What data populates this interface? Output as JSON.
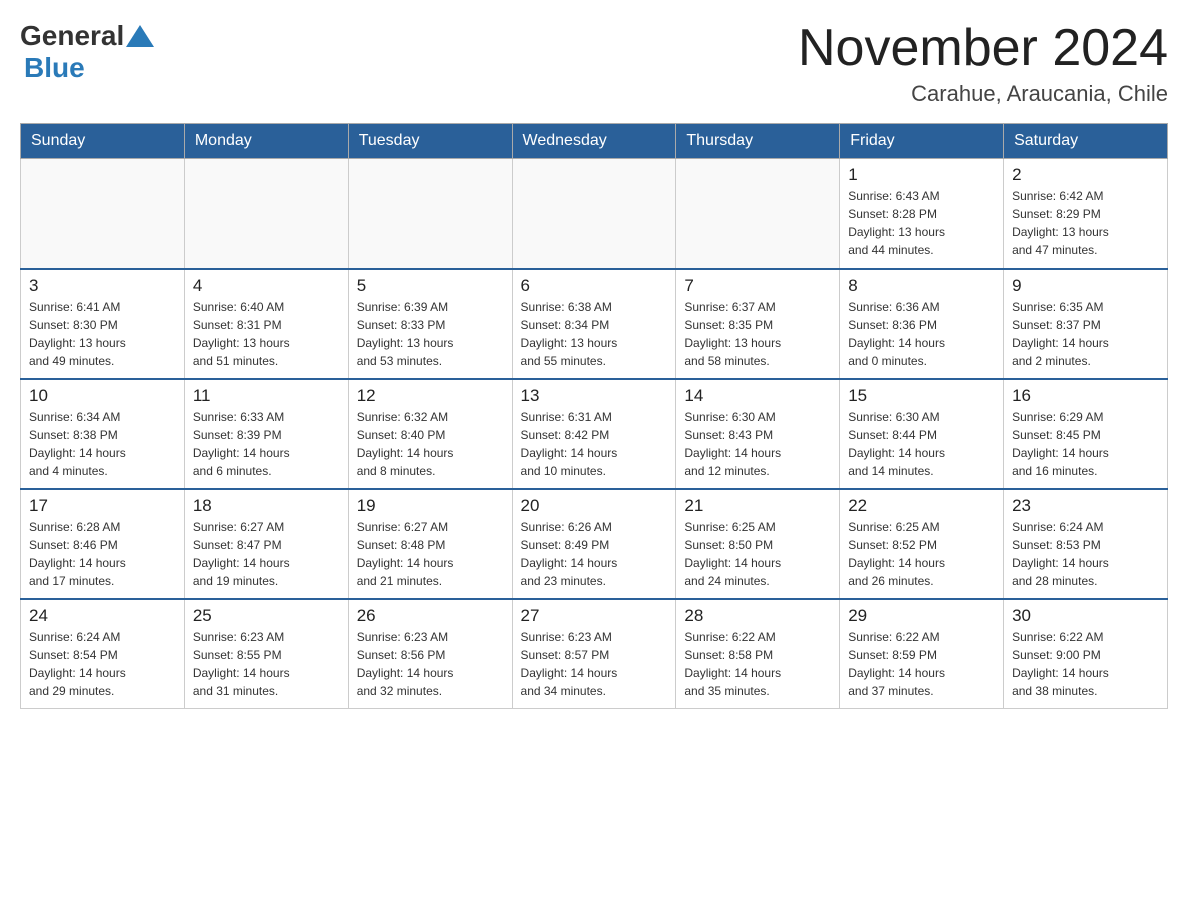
{
  "header": {
    "logo": {
      "general": "General",
      "blue": "Blue"
    },
    "title": "November 2024",
    "subtitle": "Carahue, Araucania, Chile"
  },
  "weekdays": [
    "Sunday",
    "Monday",
    "Tuesday",
    "Wednesday",
    "Thursday",
    "Friday",
    "Saturday"
  ],
  "weeks": [
    [
      {
        "day": "",
        "info": ""
      },
      {
        "day": "",
        "info": ""
      },
      {
        "day": "",
        "info": ""
      },
      {
        "day": "",
        "info": ""
      },
      {
        "day": "",
        "info": ""
      },
      {
        "day": "1",
        "info": "Sunrise: 6:43 AM\nSunset: 8:28 PM\nDaylight: 13 hours\nand 44 minutes."
      },
      {
        "day": "2",
        "info": "Sunrise: 6:42 AM\nSunset: 8:29 PM\nDaylight: 13 hours\nand 47 minutes."
      }
    ],
    [
      {
        "day": "3",
        "info": "Sunrise: 6:41 AM\nSunset: 8:30 PM\nDaylight: 13 hours\nand 49 minutes."
      },
      {
        "day": "4",
        "info": "Sunrise: 6:40 AM\nSunset: 8:31 PM\nDaylight: 13 hours\nand 51 minutes."
      },
      {
        "day": "5",
        "info": "Sunrise: 6:39 AM\nSunset: 8:33 PM\nDaylight: 13 hours\nand 53 minutes."
      },
      {
        "day": "6",
        "info": "Sunrise: 6:38 AM\nSunset: 8:34 PM\nDaylight: 13 hours\nand 55 minutes."
      },
      {
        "day": "7",
        "info": "Sunrise: 6:37 AM\nSunset: 8:35 PM\nDaylight: 13 hours\nand 58 minutes."
      },
      {
        "day": "8",
        "info": "Sunrise: 6:36 AM\nSunset: 8:36 PM\nDaylight: 14 hours\nand 0 minutes."
      },
      {
        "day": "9",
        "info": "Sunrise: 6:35 AM\nSunset: 8:37 PM\nDaylight: 14 hours\nand 2 minutes."
      }
    ],
    [
      {
        "day": "10",
        "info": "Sunrise: 6:34 AM\nSunset: 8:38 PM\nDaylight: 14 hours\nand 4 minutes."
      },
      {
        "day": "11",
        "info": "Sunrise: 6:33 AM\nSunset: 8:39 PM\nDaylight: 14 hours\nand 6 minutes."
      },
      {
        "day": "12",
        "info": "Sunrise: 6:32 AM\nSunset: 8:40 PM\nDaylight: 14 hours\nand 8 minutes."
      },
      {
        "day": "13",
        "info": "Sunrise: 6:31 AM\nSunset: 8:42 PM\nDaylight: 14 hours\nand 10 minutes."
      },
      {
        "day": "14",
        "info": "Sunrise: 6:30 AM\nSunset: 8:43 PM\nDaylight: 14 hours\nand 12 minutes."
      },
      {
        "day": "15",
        "info": "Sunrise: 6:30 AM\nSunset: 8:44 PM\nDaylight: 14 hours\nand 14 minutes."
      },
      {
        "day": "16",
        "info": "Sunrise: 6:29 AM\nSunset: 8:45 PM\nDaylight: 14 hours\nand 16 minutes."
      }
    ],
    [
      {
        "day": "17",
        "info": "Sunrise: 6:28 AM\nSunset: 8:46 PM\nDaylight: 14 hours\nand 17 minutes."
      },
      {
        "day": "18",
        "info": "Sunrise: 6:27 AM\nSunset: 8:47 PM\nDaylight: 14 hours\nand 19 minutes."
      },
      {
        "day": "19",
        "info": "Sunrise: 6:27 AM\nSunset: 8:48 PM\nDaylight: 14 hours\nand 21 minutes."
      },
      {
        "day": "20",
        "info": "Sunrise: 6:26 AM\nSunset: 8:49 PM\nDaylight: 14 hours\nand 23 minutes."
      },
      {
        "day": "21",
        "info": "Sunrise: 6:25 AM\nSunset: 8:50 PM\nDaylight: 14 hours\nand 24 minutes."
      },
      {
        "day": "22",
        "info": "Sunrise: 6:25 AM\nSunset: 8:52 PM\nDaylight: 14 hours\nand 26 minutes."
      },
      {
        "day": "23",
        "info": "Sunrise: 6:24 AM\nSunset: 8:53 PM\nDaylight: 14 hours\nand 28 minutes."
      }
    ],
    [
      {
        "day": "24",
        "info": "Sunrise: 6:24 AM\nSunset: 8:54 PM\nDaylight: 14 hours\nand 29 minutes."
      },
      {
        "day": "25",
        "info": "Sunrise: 6:23 AM\nSunset: 8:55 PM\nDaylight: 14 hours\nand 31 minutes."
      },
      {
        "day": "26",
        "info": "Sunrise: 6:23 AM\nSunset: 8:56 PM\nDaylight: 14 hours\nand 32 minutes."
      },
      {
        "day": "27",
        "info": "Sunrise: 6:23 AM\nSunset: 8:57 PM\nDaylight: 14 hours\nand 34 minutes."
      },
      {
        "day": "28",
        "info": "Sunrise: 6:22 AM\nSunset: 8:58 PM\nDaylight: 14 hours\nand 35 minutes."
      },
      {
        "day": "29",
        "info": "Sunrise: 6:22 AM\nSunset: 8:59 PM\nDaylight: 14 hours\nand 37 minutes."
      },
      {
        "day": "30",
        "info": "Sunrise: 6:22 AM\nSunset: 9:00 PM\nDaylight: 14 hours\nand 38 minutes."
      }
    ]
  ]
}
